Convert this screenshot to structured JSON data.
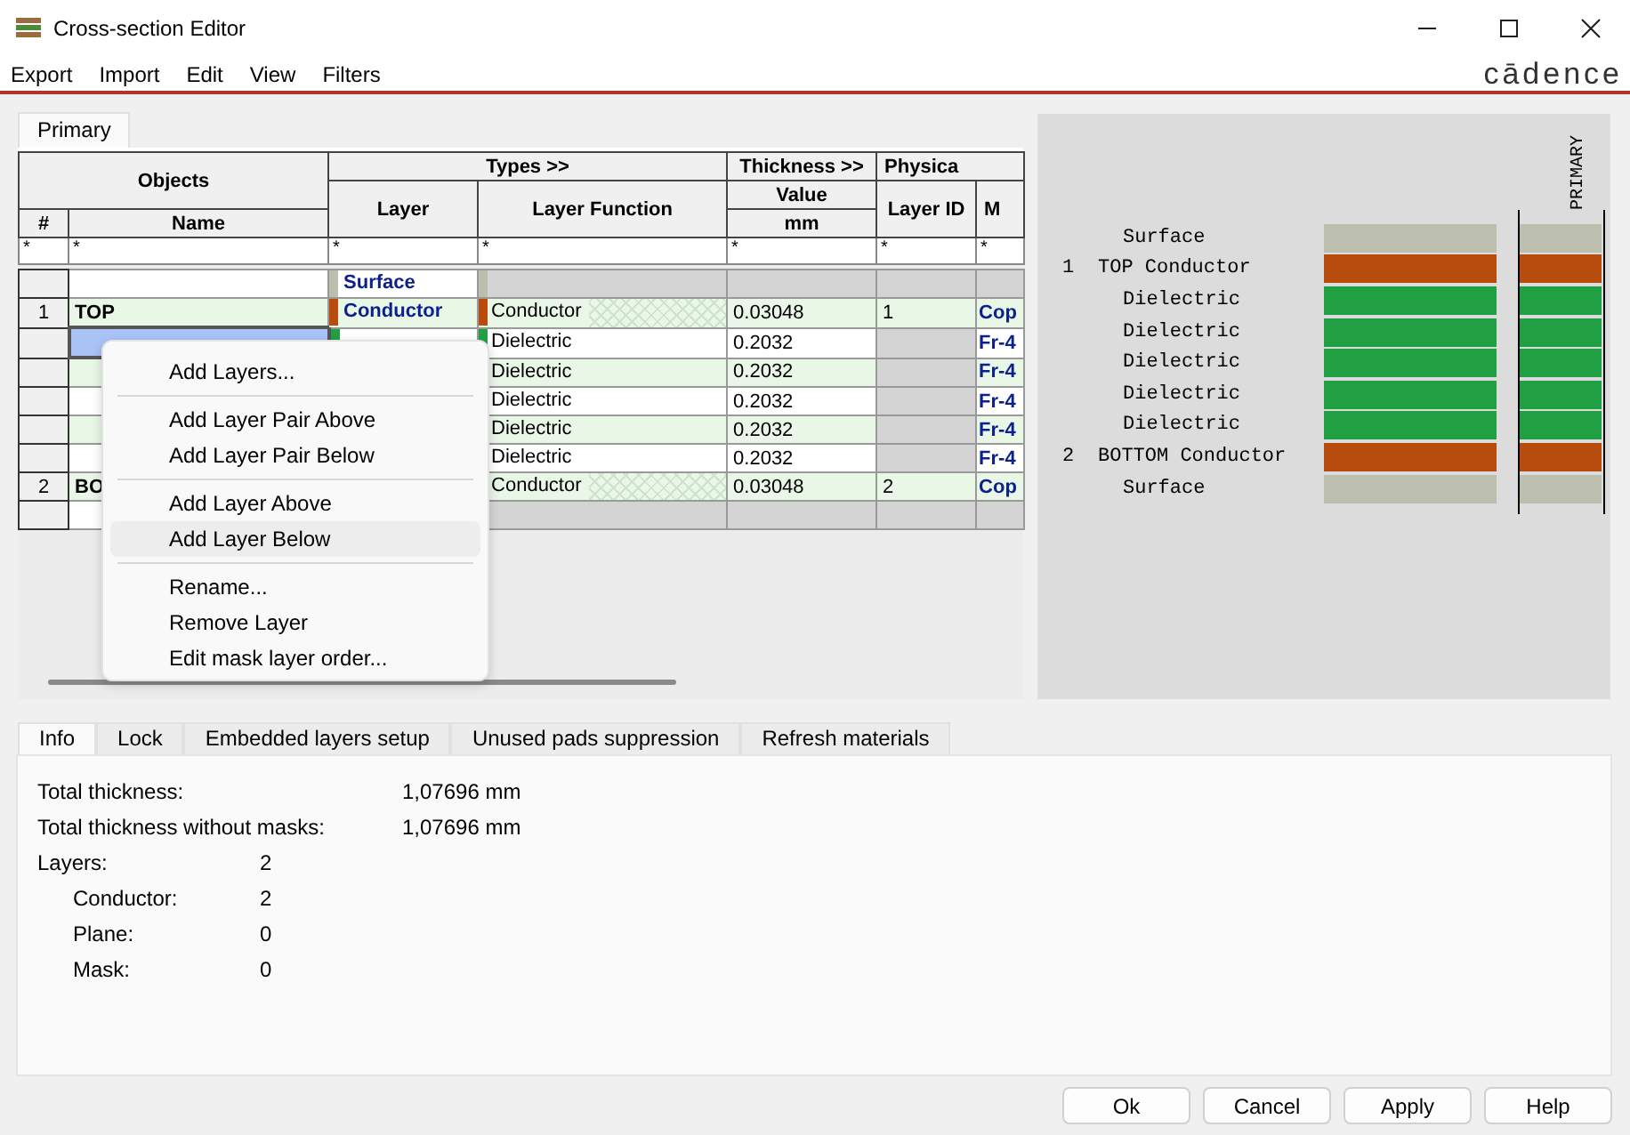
{
  "window": {
    "title": "Cross-section Editor"
  },
  "menu": [
    "Export",
    "Import",
    "Edit",
    "View",
    "Filters"
  ],
  "logo": "cādence",
  "view_tabs": [
    {
      "label": "Primary",
      "selected": true
    }
  ],
  "table": {
    "header": {
      "objects": "Objects",
      "types": "Types >>",
      "thickness": "Thickness >>",
      "physical": "Physica",
      "number": "#",
      "name": "Name",
      "layer": "Layer",
      "layer_function": "Layer Function",
      "value": "Value",
      "unit": "mm",
      "layer_id": "Layer ID",
      "material": "M"
    },
    "filters": [
      "*",
      "*",
      "*",
      "*",
      "*",
      "*",
      "*"
    ],
    "rows": [
      {
        "kind": "surface",
        "selected": false,
        "layer": "Surface"
      },
      {
        "kind": "conductor",
        "selected": false,
        "number": "1",
        "name": "TOP",
        "layer": "Conductor",
        "function": "Conductor",
        "thickness": "0.03048",
        "layer_id": "1",
        "material": "Cop"
      },
      {
        "kind": "dielectric",
        "selected": true,
        "function": "Dielectric",
        "thickness": "0.2032",
        "material": "Fr-4"
      },
      {
        "kind": "dielectric",
        "selected": false,
        "function": "Dielectric",
        "thickness": "0.2032",
        "material": "Fr-4"
      },
      {
        "kind": "dielectric",
        "selected": false,
        "function": "Dielectric",
        "thickness": "0.2032",
        "material": "Fr-4"
      },
      {
        "kind": "dielectric",
        "selected": false,
        "function": "Dielectric",
        "thickness": "0.2032",
        "material": "Fr-4"
      },
      {
        "kind": "dielectric",
        "selected": false,
        "function": "Dielectric",
        "thickness": "0.2032",
        "material": "Fr-4"
      },
      {
        "kind": "conductor",
        "selected": false,
        "number": "2",
        "name": "BO",
        "function": "Conductor",
        "thickness": "0.03048",
        "layer_id": "2",
        "material": "Cop"
      },
      {
        "kind": "empty",
        "selected": false
      }
    ]
  },
  "context_menu": {
    "groups": [
      [
        {
          "label": "Add Layers...",
          "selected": false
        }
      ],
      [
        {
          "label": "Add Layer Pair Above",
          "selected": false
        },
        {
          "label": "Add Layer Pair Below",
          "selected": false
        }
      ],
      [
        {
          "label": "Add Layer Above",
          "selected": false
        },
        {
          "label": "Add Layer Below",
          "selected": true
        }
      ],
      [
        {
          "label": "Rename...",
          "selected": false
        },
        {
          "label": "Remove Layer",
          "selected": false
        },
        {
          "label": "Edit mask layer order...",
          "selected": false
        }
      ]
    ]
  },
  "stack": {
    "column_label": "PRIMARY",
    "layers": [
      {
        "kind": "surface",
        "name": "Surface"
      },
      {
        "kind": "conductor",
        "number": "1",
        "name": "TOP Conductor"
      },
      {
        "kind": "dielectric",
        "name": "Dielectric"
      },
      {
        "kind": "dielectric",
        "name": "Dielectric"
      },
      {
        "kind": "dielectric",
        "name": "Dielectric"
      },
      {
        "kind": "dielectric",
        "name": "Dielectric"
      },
      {
        "kind": "dielectric",
        "name": "Dielectric"
      },
      {
        "kind": "conductor",
        "number": "2",
        "name": "BOTTOM Conductor"
      },
      {
        "kind": "surface",
        "name": "Surface"
      }
    ]
  },
  "info_tabs": [
    {
      "label": "Info",
      "selected": true
    },
    {
      "label": "Lock",
      "selected": false
    },
    {
      "label": "Embedded layers setup",
      "selected": false
    },
    {
      "label": "Unused pads suppression",
      "selected": false
    },
    {
      "label": "Refresh materials",
      "selected": false
    }
  ],
  "info": {
    "totals": [
      {
        "label": "Total thickness:",
        "value": "1,07696 mm"
      },
      {
        "label": "Total thickness without masks:",
        "value": "1,07696 mm"
      }
    ],
    "layers": {
      "label": "Layers:",
      "value": "2",
      "children": [
        {
          "label": "Conductor:",
          "value": "2"
        },
        {
          "label": "Plane:",
          "value": "0"
        },
        {
          "label": "Mask:",
          "value": "0"
        }
      ]
    }
  },
  "buttons": [
    "Ok",
    "Cancel",
    "Apply",
    "Help"
  ]
}
